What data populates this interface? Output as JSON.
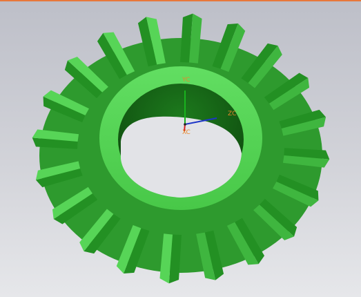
{
  "viewport": {
    "model": "bevel-gear",
    "tooth_count": 20,
    "colors": {
      "background_top": "#bdbfc8",
      "background_bottom": "#e6e7ea",
      "part_light": "#57d557",
      "part_mid": "#3fb63f",
      "part_dark": "#239023",
      "bore_inner": "#135d13",
      "top_edge": "#e8783a"
    }
  },
  "csys": {
    "y_label": "YC",
    "z_label": "ZC",
    "x_label": "XC",
    "label_color": "#e8862b",
    "axis_colors": {
      "y": "#19b31e",
      "z": "#1e36c8",
      "x": "#d32020"
    }
  }
}
